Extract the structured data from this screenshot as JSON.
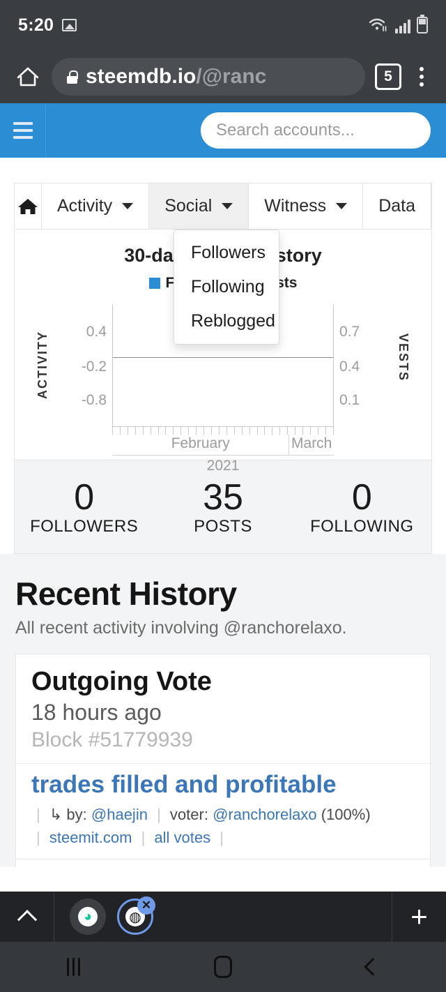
{
  "status_bar": {
    "time": "5:20",
    "image_icon": "image-icon",
    "wifi_icon": "wifi-icon",
    "signal_icon": "cellular-signal-icon",
    "battery_icon": "battery-icon"
  },
  "browser": {
    "home_icon": "home-icon",
    "lock_icon": "lock-icon",
    "url_domain": "steemdb.io",
    "url_path": "/@ranc",
    "tab_count": "5",
    "menu_icon": "kebab-menu-icon",
    "bottom": {
      "expand_icon": "chevron-up-icon",
      "tab_one_icon": "browser-tab-icon",
      "tab_two_icon": "browser-tab-active-icon",
      "close_label": "✕",
      "new_tab_label": "+"
    }
  },
  "android_nav": {
    "recents_icon": "recents-icon",
    "home_icon": "home-icon",
    "back_icon": "back-icon"
  },
  "site_nav": {
    "menu_icon": "hamburger-menu-icon",
    "search_placeholder": "Search accounts...",
    "search_value": "",
    "search_icon": "search-icon",
    "brand_color": "#2b8dd4"
  },
  "tabs": [
    {
      "label": "",
      "icon": "home-icon",
      "active": false,
      "has_caret": false
    },
    {
      "label": "Activity",
      "active": false,
      "has_caret": true
    },
    {
      "label": "Social",
      "active": true,
      "has_caret": true
    },
    {
      "label": "Witness",
      "active": false,
      "has_caret": true
    },
    {
      "label": "Data",
      "active": false,
      "has_caret": false
    }
  ],
  "dropdown": {
    "open_for": "Social",
    "items": [
      {
        "label": "Followers"
      },
      {
        "label": "Following"
      },
      {
        "label": "Reblogged"
      }
    ]
  },
  "chart_data": {
    "type": "line",
    "title": "30-day activity history",
    "title_visible_left": "30-da",
    "title_visible_right": "history",
    "legend": [
      {
        "name": "Followers",
        "color": "#2b8dd4",
        "visible_text": "ers"
      },
      {
        "name": "Vests",
        "color": "#f02b12",
        "visible_text": "Vests"
      }
    ],
    "legend_position": "top-center",
    "xlabel": "2021",
    "x_ticks": [
      "February",
      "March"
    ],
    "left_axis": {
      "label": "ACTIVITY",
      "ticks": [
        "0.4",
        "-0.2",
        "-0.8"
      ]
    },
    "right_axis": {
      "label": "VESTS",
      "ticks": [
        "0.7",
        "0.4",
        "0.1"
      ]
    },
    "series": [
      {
        "name": "Followers",
        "values": [
          0,
          0,
          0,
          0,
          0,
          0,
          0,
          0,
          0,
          0
        ]
      },
      {
        "name": "Vests",
        "values": [
          0,
          0,
          0,
          0,
          0,
          0,
          0,
          0,
          0,
          0
        ]
      }
    ],
    "grid": false
  },
  "stats": [
    {
      "value": "0",
      "label": "FOLLOWERS"
    },
    {
      "value": "35",
      "label": "POSTS"
    },
    {
      "value": "0",
      "label": "FOLLOWING"
    }
  ],
  "recent_history": {
    "title": "Recent History",
    "subtitle": "All recent activity involving @ranchorelaxo.",
    "entries": [
      {
        "kind": "Outgoing Vote",
        "time": "18 hours ago",
        "block": "Block #51779939",
        "post_title": "trades filled and profitable",
        "arrow": "↳",
        "by_label": "by:",
        "by_user": "@haejin",
        "voter_label": "voter:",
        "voter_user": "@ranchorelaxo",
        "weight": "(100%)",
        "link_steemit": "steemit.com",
        "link_all_votes": "all votes"
      }
    ]
  }
}
